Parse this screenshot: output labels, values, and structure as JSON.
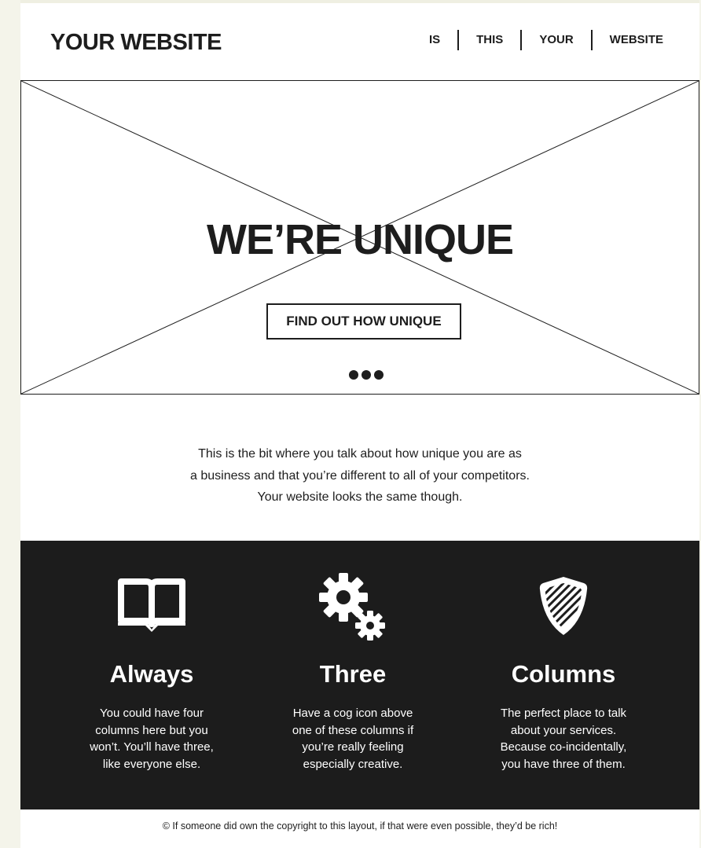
{
  "header": {
    "logo": "YOUR WEBSITE",
    "nav": [
      "IS",
      "THIS",
      "YOUR",
      "WEBSITE"
    ]
  },
  "hero": {
    "title": "WE’RE UNIQUE",
    "button_label": "FIND OUT HOW UNIQUE",
    "slides": 3
  },
  "intro": {
    "lines": [
      "This is the bit where you talk about how unique you are as",
      "a business and that you’re different to all of your competitors.",
      "Your website looks the same though."
    ]
  },
  "features": [
    {
      "icon": "book-icon",
      "title": "Always",
      "lines": [
        "You could have four",
        "columns here but you",
        "won’t. You’ll have three,",
        "like everyone else."
      ]
    },
    {
      "icon": "cogs-icon",
      "title": "Three",
      "lines": [
        "Have a cog icon above",
        "one of these columns if",
        "you’re really feeling",
        "especially creative."
      ]
    },
    {
      "icon": "shield-icon",
      "title": "Columns",
      "lines": [
        "The perfect place to talk",
        "about your services.",
        "Because co-incidentally,",
        "you have three of them."
      ]
    }
  ],
  "footer": {
    "text": "© If someone did own the copyright to this layout, if that were even possible, they’d be rich!"
  },
  "colors": {
    "ink": "#1d1d1d",
    "dark_band": "#1c1c1c",
    "background": "#f4f4ea",
    "page": "#ffffff"
  }
}
